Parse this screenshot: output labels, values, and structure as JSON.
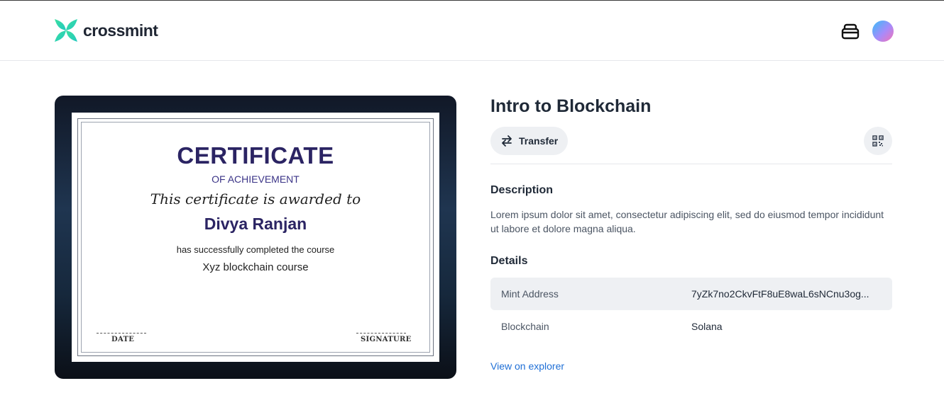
{
  "header": {
    "brand_name": "crossmint",
    "logo_icon": "crossmint-logo-icon",
    "wallet_icon": "wallet-icon",
    "avatar_colors": [
      "#38bdf8",
      "#a78bfa",
      "#f472b6"
    ]
  },
  "certificate": {
    "title": "CERTIFICATE",
    "subtitle": "OF ACHIEVEMENT",
    "awarded_text": "This certificate is awarded to",
    "recipient": "Divya Ranjan",
    "completed_text": "has successfully completed the course",
    "course": "Xyz blockchain course",
    "date_label": "DATE",
    "signature_label": "SIGNATURE"
  },
  "item": {
    "title": "Intro to Blockchain",
    "transfer_label": "Transfer",
    "transfer_icon": "arrows-swap-icon",
    "qr_icon": "qr-code-icon"
  },
  "description": {
    "heading": "Description",
    "text": "Lorem ipsum dolor sit amet, consectetur adipiscing elit, sed do eiusmod tempor incididunt ut labore et dolore magna aliqua."
  },
  "details": {
    "heading": "Details",
    "rows": [
      {
        "key": "Mint Address",
        "value": "7yZk7no2CkvFtF8uE8waL6sNCnu3og..."
      },
      {
        "key": "Blockchain",
        "value": "Solana"
      }
    ]
  },
  "explorer_link": "View on explorer",
  "colors": {
    "accent_link": "#1f6fd6",
    "brand_green": "#2ed3a4",
    "certificate_ink": "#2b2463"
  }
}
